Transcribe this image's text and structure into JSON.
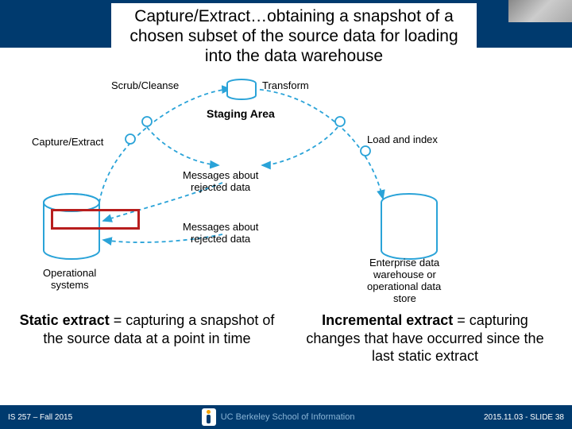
{
  "title": "Capture/Extract…obtaining a snapshot of a chosen subset of the source data for loading into the data warehouse",
  "diagram": {
    "nodes": {
      "scrub": "Scrub/Cleanse",
      "transform": "Transform",
      "staging": "Staging Area",
      "capture": "Capture/Extract",
      "load": "Load and index",
      "msg_about": "Messages about",
      "rejected_data": "rejected data",
      "msg_about2": "Messages about",
      "rejected_data2": "rejected data",
      "op_sys1": "Operational",
      "op_sys2": "systems",
      "edw1": "Enterprise data",
      "edw2": "warehouse or",
      "edw3": "operational data",
      "edw4": "store"
    }
  },
  "defs": {
    "static_bold": "Static extract",
    "static_rest": " = capturing a snapshot of the source data at a point in time",
    "incr_bold": "Incremental extract",
    "incr_rest": " = capturing changes that have occurred since the last static extract"
  },
  "footer": {
    "left": "IS 257 – Fall 2015",
    "center": "UC Berkeley School of Information",
    "right": "2015.11.03 - SLIDE 38"
  }
}
